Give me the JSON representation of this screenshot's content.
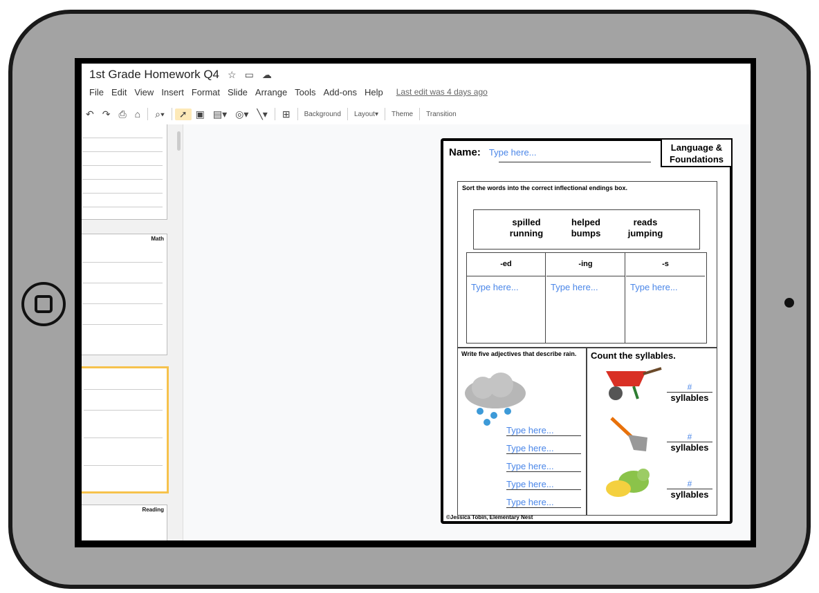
{
  "app": {
    "title": "1st Grade Homework Q4",
    "title_icons": [
      "star-icon",
      "folder-icon",
      "cloud-icon"
    ],
    "menu": [
      "File",
      "Edit",
      "View",
      "Insert",
      "Format",
      "Slide",
      "Arrange",
      "Tools",
      "Add-ons",
      "Help"
    ],
    "last_edit": "Last edit was 4 days ago"
  },
  "toolbar": {
    "background": "Background",
    "layout": "Layout",
    "theme": "Theme",
    "transition": "Transition"
  },
  "filmstrip": {
    "thumb2_label": "Math",
    "thumb4_label": "Reading"
  },
  "slide": {
    "name_label": "Name:",
    "name_placeholder": "Type here...",
    "tag_line1": "Language &",
    "tag_line2": "Foundations",
    "sort_instruction": "Sort the words into the correct inflectional endings box.",
    "word_bank": {
      "w1": "spilled",
      "w2": "running",
      "w3": "helped",
      "w4": "bumps",
      "w5": "reads",
      "w6": "jumping"
    },
    "endings": {
      "ed": "-ed",
      "ing": "-ing",
      "s": "-s",
      "placeholder": "Type here..."
    },
    "adjectives_instruction": "Write five adjectives that describe rain.",
    "adjective_fields": [
      "Type here...",
      "Type here...",
      "Type here...",
      "Type here...",
      "Type here..."
    ],
    "syllables_title": "Count the syllables.",
    "syllable_items": [
      {
        "num": "#",
        "label": "syllables"
      },
      {
        "num": "#",
        "label": "syllables"
      },
      {
        "num": "#",
        "label": "syllables"
      }
    ],
    "copyright": "©Jessica Tobin, Elementary Nest"
  },
  "colors": {
    "accent": "#4a86e8",
    "tablet": "#a3a3a3",
    "selection": "#f6c24c"
  }
}
